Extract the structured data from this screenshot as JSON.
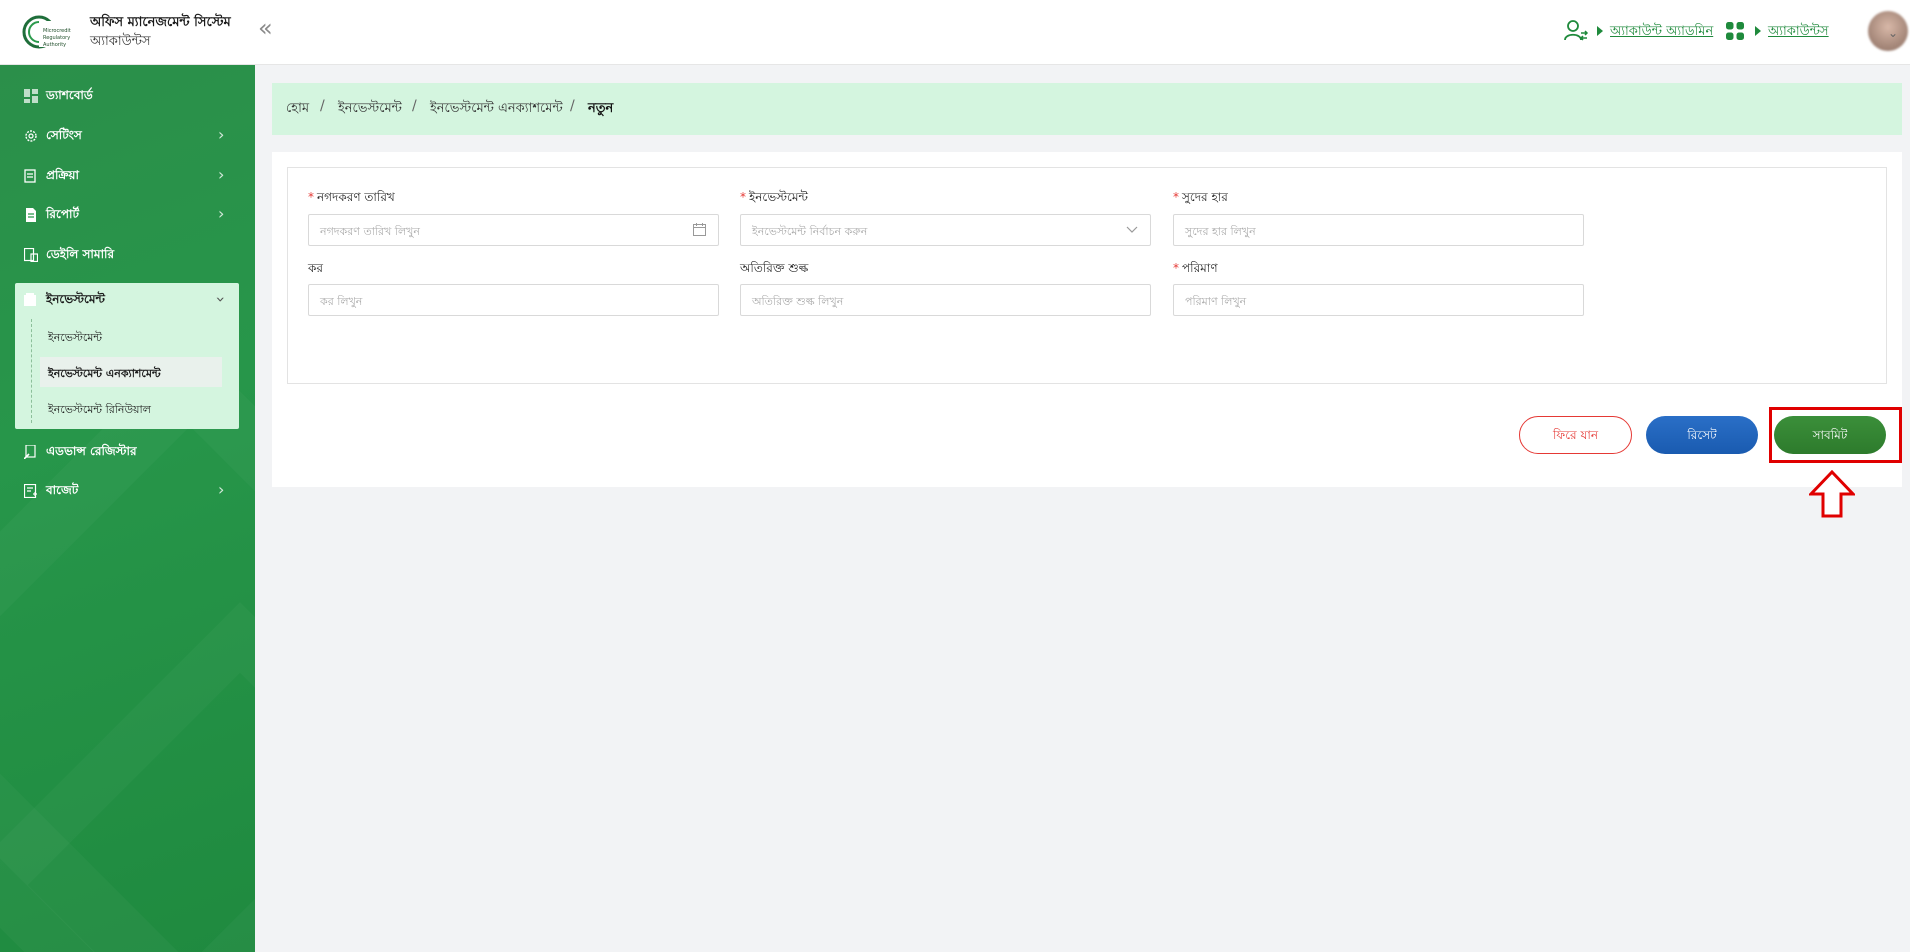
{
  "header": {
    "app_title": "অফিস ম্যানেজমেন্ট সিস্টেম",
    "app_subtitle": "অ্যাকাউন্টস",
    "collapse_glyph": "«",
    "role_link": "অ্যাকাউন্ট অ্যাডমিন",
    "module_link": "অ্যাকাউন্টস",
    "logo_text": [
      "Microcredit",
      "Regulatory",
      "Authority"
    ]
  },
  "sidebar": {
    "items": [
      {
        "label": "ড্যাশবোর্ড",
        "icon": "dashboard-icon"
      },
      {
        "label": "সেটিংস",
        "icon": "gear-icon"
      },
      {
        "label": "প্রক্রিয়া",
        "icon": "process-icon"
      },
      {
        "label": "রিপোর্ট",
        "icon": "report-icon"
      },
      {
        "label": "ডেইলি সামারি",
        "icon": "daily-summary-icon"
      },
      {
        "label": "ইনভেস্টমেন্ট",
        "icon": "investment-icon"
      },
      {
        "label": "এডভান্স রেজিস্টার",
        "icon": "advance-register-icon"
      },
      {
        "label": "বাজেট",
        "icon": "budget-icon"
      }
    ],
    "investment_sub": [
      {
        "label": "ইনভেস্টমেন্ট"
      },
      {
        "label": "ইনভেস্টমেন্ট এনক্যাশমেন্ট"
      },
      {
        "label": "ইনভেস্টমেন্ট রিনিউয়াল"
      }
    ]
  },
  "breadcrumb": [
    "হোম",
    "ইনভেস্টমেন্ট",
    "ইনভেস্টমেন্ট এনক্যাশমেন্ট",
    "নতুন"
  ],
  "form": {
    "fields": [
      {
        "label": "নগদকরণ তারিখ",
        "required": true,
        "placeholder": "নগদকরণ তারিখ লিখুন",
        "suffix": "calendar-icon"
      },
      {
        "label": "ইনভেস্টমেন্ট",
        "required": true,
        "placeholder": "ইনভেস্টমেন্ট নির্বাচন করুন",
        "suffix": "chevron-down-icon"
      },
      {
        "label": "সুদের হার",
        "required": true,
        "placeholder": "সুদের হার লিখুন"
      },
      {
        "label": "কর",
        "required": false,
        "placeholder": "কর লিখুন"
      },
      {
        "label": "অতিরিক্ত শুল্ক",
        "required": false,
        "placeholder": "অতিরিক্ত শুল্ক লিখুন"
      },
      {
        "label": "পরিমাণ",
        "required": true,
        "placeholder": "পরিমাণ লিখুন"
      }
    ],
    "required_mark": "*",
    "back_label": "ফিরে যান",
    "reset_label": "রিসেট",
    "submit_label": "সাবমিট"
  },
  "colors": {
    "sidebar_green": "#27964a",
    "accent_green": "#1f8a3c",
    "light_green": "#d4f5df",
    "reset_blue": "#1a5bb0",
    "submit_green": "#2d7b2c",
    "danger_red": "#e53935",
    "annotation_red": "#e00000"
  }
}
